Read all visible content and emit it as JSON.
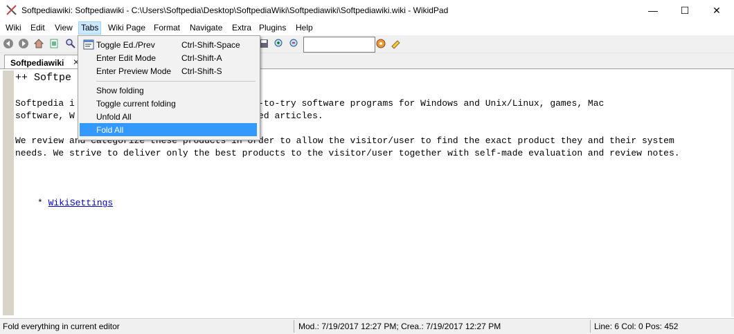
{
  "window": {
    "title": "Softpediawiki: Softpediawiki - C:\\Users\\Softpedia\\Desktop\\SoftpediaWiki\\Softpediawiki\\Softpediawiki.wiki - WikidPad",
    "minimize_glyph": "—",
    "maximize_glyph": "☐",
    "close_glyph": "✕"
  },
  "menubar": {
    "items": [
      "Wiki",
      "Edit",
      "View",
      "Tabs",
      "Wiki Page",
      "Format",
      "Navigate",
      "Extra",
      "Plugins",
      "Help"
    ],
    "active": "Tabs"
  },
  "toolbar": {
    "icons": [
      "back-icon",
      "forward-icon",
      "home-icon",
      "search-icon",
      "save-icon",
      "zoom-in-icon",
      "zoom-out-icon",
      "settings-icon",
      "spellcheck-icon"
    ],
    "search_value": ""
  },
  "tabs": [
    {
      "label": "Softpediawiki",
      "close": "✕"
    }
  ],
  "editor": {
    "lines": [
      "++ Softpe",
      "Softpedia i                        e and free-to-try software programs for Windows and Unix/Linux, games, Mac",
      "software, W                        d IT-related articles.",
      "We review and categorize these products in order to allow the visitor/user to find the exact product they and their system",
      "needs. We strive to deliver only the best products to the visitor/user together with self-made evaluation and review notes."
    ],
    "bullet_prefix": "* ",
    "link_text": "WikiSettings"
  },
  "dropdown": {
    "items": [
      {
        "label": "Toggle Ed./Prev",
        "shortcut": "Ctrl-Shift-Space",
        "icon": "toggle-preview-icon"
      },
      {
        "label": "Enter Edit Mode",
        "shortcut": "Ctrl-Shift-A"
      },
      {
        "label": "Enter Preview Mode",
        "shortcut": "Ctrl-Shift-S"
      },
      {
        "label": "Show folding"
      },
      {
        "label": "Toggle current folding"
      },
      {
        "label": "Unfold All"
      },
      {
        "label": "Fold All"
      }
    ],
    "highlighted": "Fold All"
  },
  "statusbar": {
    "message": "Fold everything in current editor",
    "dates": "Mod.: 7/19/2017 12:27 PM; Crea.: 7/19/2017 12:27 PM",
    "position": "Line: 6 Col: 0 Pos: 452"
  },
  "colors": {
    "highlight": "#3399ff",
    "menu_active": "#cce8ff",
    "link": "#0000cc",
    "gutter": "#d9d4c8"
  }
}
